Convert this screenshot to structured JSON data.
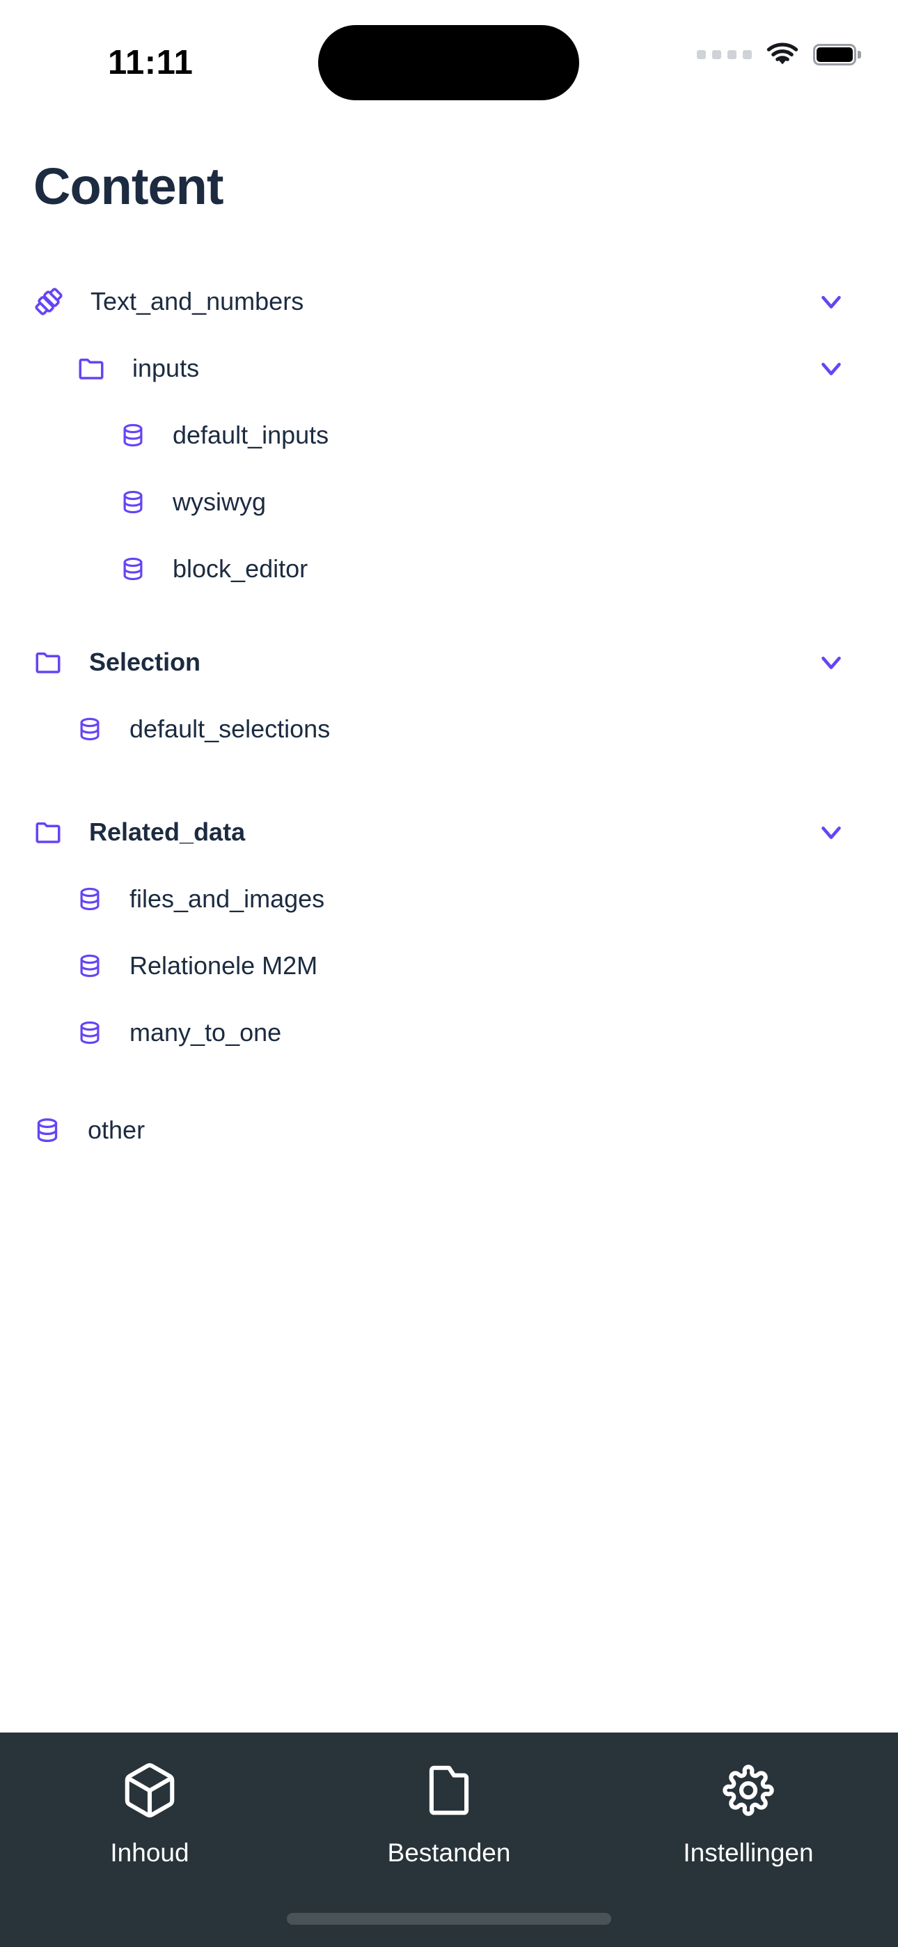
{
  "status_bar": {
    "time": "11:11",
    "cellular_icon": "cellular-dots-icon",
    "wifi_icon": "wifi-icon",
    "battery_icon": "battery-full-icon",
    "dynamic_island": "dynamic-island"
  },
  "header": {
    "title": "Content"
  },
  "colors": {
    "accent_purple": "#6644f5",
    "text_navy": "#1c2b40",
    "tabbar_bg": "#28333a",
    "page_bg": "#ffffff"
  },
  "tree": {
    "items": [
      {
        "label": "Text_and_numbers",
        "icon": "blocks-icon",
        "level": 0,
        "bold": false,
        "chevron": "chevron-down-icon"
      },
      {
        "label": "inputs",
        "icon": "folder-icon",
        "level": 1,
        "bold": false,
        "chevron": "chevron-down-icon"
      },
      {
        "label": "default_inputs",
        "icon": "database-icon",
        "level": 2,
        "bold": false,
        "chevron": null
      },
      {
        "label": "wysiwyg",
        "icon": "database-icon",
        "level": 2,
        "bold": false,
        "chevron": null
      },
      {
        "label": "block_editor",
        "icon": "database-icon",
        "level": 2,
        "bold": false,
        "chevron": null
      },
      {
        "label": "Selection",
        "icon": "folder-icon",
        "level": 0,
        "bold": true,
        "chevron": "chevron-down-icon"
      },
      {
        "label": "default_selections",
        "icon": "database-icon",
        "level": 1,
        "bold": false,
        "chevron": null
      },
      {
        "label": "Related_data",
        "icon": "folder-icon",
        "level": 0,
        "bold": true,
        "chevron": "chevron-down-icon"
      },
      {
        "label": "files_and_images",
        "icon": "database-icon",
        "level": 1,
        "bold": false,
        "chevron": null
      },
      {
        "label": "Relationele M2M",
        "icon": "database-icon",
        "level": 1,
        "bold": false,
        "chevron": null
      },
      {
        "label": "many_to_one",
        "icon": "database-icon",
        "level": 1,
        "bold": false,
        "chevron": null
      },
      {
        "label": "other",
        "icon": "database-icon",
        "level": 0,
        "bold": false,
        "chevron": null
      }
    ]
  },
  "tabbar": {
    "tabs": [
      {
        "label": "Inhoud",
        "icon": "box-icon"
      },
      {
        "label": "Bestanden",
        "icon": "folder-icon"
      },
      {
        "label": "Instellingen",
        "icon": "gear-icon"
      }
    ]
  }
}
